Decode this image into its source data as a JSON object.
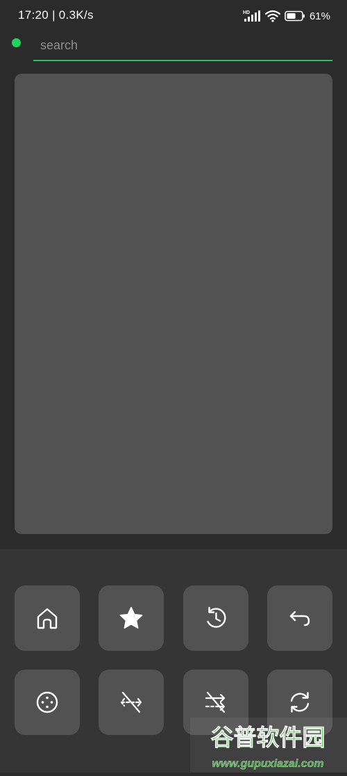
{
  "status_bar": {
    "time_speed": "17:20 | 0.3K/s",
    "network_label": "HD",
    "battery_percent": "61%",
    "battery_level": 0.61
  },
  "search": {
    "placeholder": "search",
    "value": ""
  },
  "colors": {
    "accent": "#22c55e",
    "status_dot": "#1ed35f",
    "background": "#2b2b2c",
    "panel": "#353536",
    "tile": "#525253"
  },
  "toolbar": {
    "buttons": [
      {
        "icon": "home-icon"
      },
      {
        "icon": "star-icon"
      },
      {
        "icon": "history-icon"
      },
      {
        "icon": "back-arrow-icon"
      },
      {
        "icon": "dots-menu-icon"
      },
      {
        "icon": "no-images-icon"
      },
      {
        "icon": "no-ads-icon"
      },
      {
        "icon": "refresh-icon"
      }
    ]
  },
  "watermark": {
    "title": "谷普软件园",
    "url": "www.gupuxiazai.com"
  }
}
